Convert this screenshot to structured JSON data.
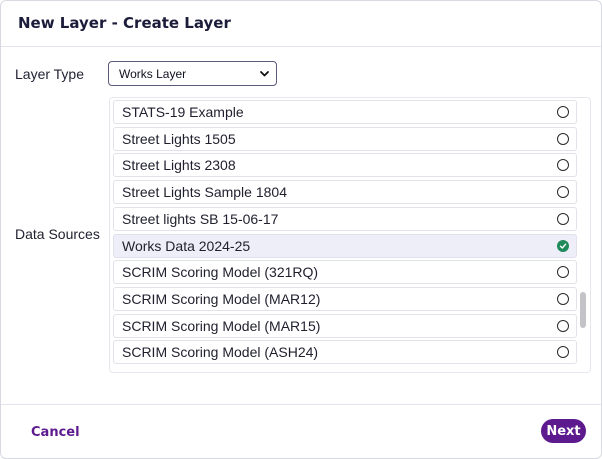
{
  "dialog": {
    "title": "New Layer - Create Layer"
  },
  "layer_type": {
    "label": "Layer Type",
    "selected": "Works Layer"
  },
  "data_sources": {
    "label": "Data Sources",
    "items": [
      {
        "label": "STATS-19 Example",
        "selected": false
      },
      {
        "label": "Street Lights 1505",
        "selected": false
      },
      {
        "label": "Street Lights 2308",
        "selected": false
      },
      {
        "label": "Street Lights Sample 1804",
        "selected": false
      },
      {
        "label": "Street lights SB 15-06-17",
        "selected": false
      },
      {
        "label": "Works Data 2024-25",
        "selected": true
      },
      {
        "label": "SCRIM Scoring Model (321RQ)",
        "selected": false
      },
      {
        "label": "SCRIM Scoring Model (MAR12)",
        "selected": false
      },
      {
        "label": "SCRIM Scoring Model (MAR15)",
        "selected": false
      },
      {
        "label": "SCRIM Scoring Model (ASH24)",
        "selected": false
      }
    ],
    "scroll_position": 0.82
  },
  "footer": {
    "cancel_label": "Cancel",
    "next_label": "Next"
  },
  "colors": {
    "accent": "#5d1a8e",
    "selected_row": "#eeeef8",
    "checked_radio": "#1f8a5b"
  }
}
